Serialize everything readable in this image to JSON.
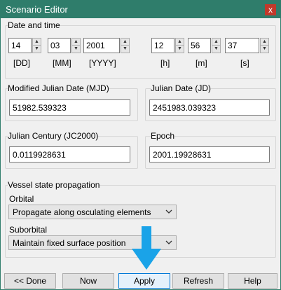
{
  "window": {
    "title": "Scenario Editor",
    "close_label": "x"
  },
  "date_time": {
    "group_label": "Date and time",
    "day": {
      "value": "14",
      "unit": "[DD]"
    },
    "month": {
      "value": "03",
      "unit": "[MM]"
    },
    "year": {
      "value": "2001",
      "unit": "[YYYY]"
    },
    "hour": {
      "value": "12",
      "unit": "[h]"
    },
    "minute": {
      "value": "56",
      "unit": "[m]"
    },
    "second": {
      "value": "37",
      "unit": "[s]"
    }
  },
  "mjd": {
    "label": "Modified Julian Date (MJD)",
    "value": "51982.539323"
  },
  "jd": {
    "label": "Julian Date (JD)",
    "value": "2451983.039323"
  },
  "jc": {
    "label": "Julian Century (JC2000)",
    "value": "0.0119928631"
  },
  "epoch": {
    "label": "Epoch",
    "value": "2001.19928631"
  },
  "vessel": {
    "group_label": "Vessel state propagation",
    "orbital_label": "Orbital",
    "orbital_value": "Propagate along osculating elements",
    "suborbital_label": "Suborbital",
    "suborbital_value": "Maintain fixed surface position"
  },
  "buttons": {
    "done": "<< Done",
    "now": "Now",
    "apply": "Apply",
    "refresh": "Refresh",
    "help": "Help"
  },
  "colors": {
    "titlebar": "#2f7d6b",
    "close": "#c0392b",
    "annotation_arrow": "#1aa3e8"
  },
  "icons": {
    "spin_up": "triangle-up",
    "spin_down": "triangle-down",
    "combo": "chevron-down",
    "annotation": "down-arrow"
  }
}
